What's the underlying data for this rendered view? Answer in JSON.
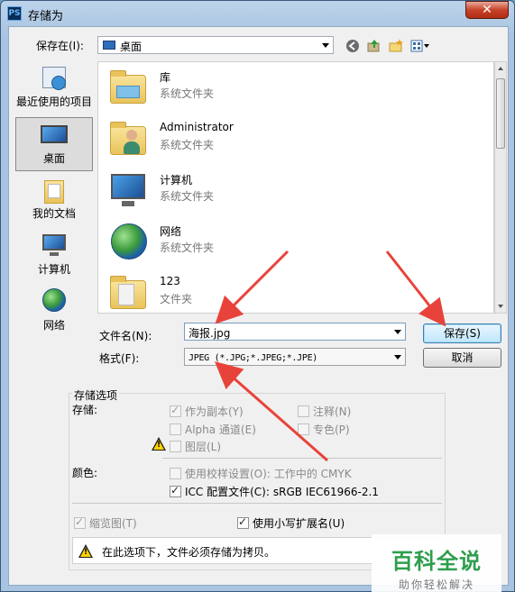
{
  "window": {
    "app_icon": "PS",
    "title": "存储为",
    "close_label": "✕"
  },
  "toolbar": {
    "save_in_label": "保存在(I):",
    "save_in_value": "桌面",
    "icons": [
      "back-icon",
      "up-folder-icon",
      "new-folder-icon",
      "view-menu-icon"
    ]
  },
  "places": [
    {
      "label": "最近使用的项目",
      "icon": "recent-items-icon"
    },
    {
      "label": "桌面",
      "icon": "desktop-icon",
      "selected": true
    },
    {
      "label": "我的文档",
      "icon": "documents-icon"
    },
    {
      "label": "计算机",
      "icon": "computer-icon"
    },
    {
      "label": "网络",
      "icon": "network-icon"
    }
  ],
  "files": [
    {
      "name": "库",
      "type": "系统文件夹",
      "icon": "library-icon"
    },
    {
      "name": "Administrator",
      "type": "系统文件夹",
      "icon": "user-folder-icon"
    },
    {
      "name": "计算机",
      "type": "系统文件夹",
      "icon": "computer-icon"
    },
    {
      "name": "网络",
      "type": "系统文件夹",
      "icon": "network-icon"
    },
    {
      "name": "123",
      "type": "文件夹",
      "icon": "folder-icon"
    }
  ],
  "filename": {
    "label": "文件名(N):",
    "value": "海报.jpg"
  },
  "format": {
    "label": "格式(F):",
    "value": "JPEG (*.JPG;*.JPEG;*.JPE)"
  },
  "buttons": {
    "save": "保存(S)",
    "cancel": "取消"
  },
  "options": {
    "group_title": "存储选项",
    "storage_label": "存储:",
    "as_copy": "作为副本(Y)",
    "notes": "注释(N)",
    "alpha": "Alpha 通道(E)",
    "spot": "专色(P)",
    "layers": "图层(L)",
    "color_label": "颜色:",
    "proof": "使用校样设置(O):",
    "proof_value": "工作中的 CMYK",
    "icc": "ICC 配置文件(C):",
    "icc_value": "sRGB IEC61966-2.1",
    "thumbnail": "缩览图(T)",
    "lowercase_ext": "使用小写扩展名(U)"
  },
  "notice": {
    "message": "在此选项下，文件必须存储为拷贝。"
  },
  "watermark": {
    "title": "百科全说",
    "subtitle": "助你轻松解决"
  },
  "colors": {
    "arrow": "#e8433a",
    "watermark_green": "#2e9e4d"
  }
}
